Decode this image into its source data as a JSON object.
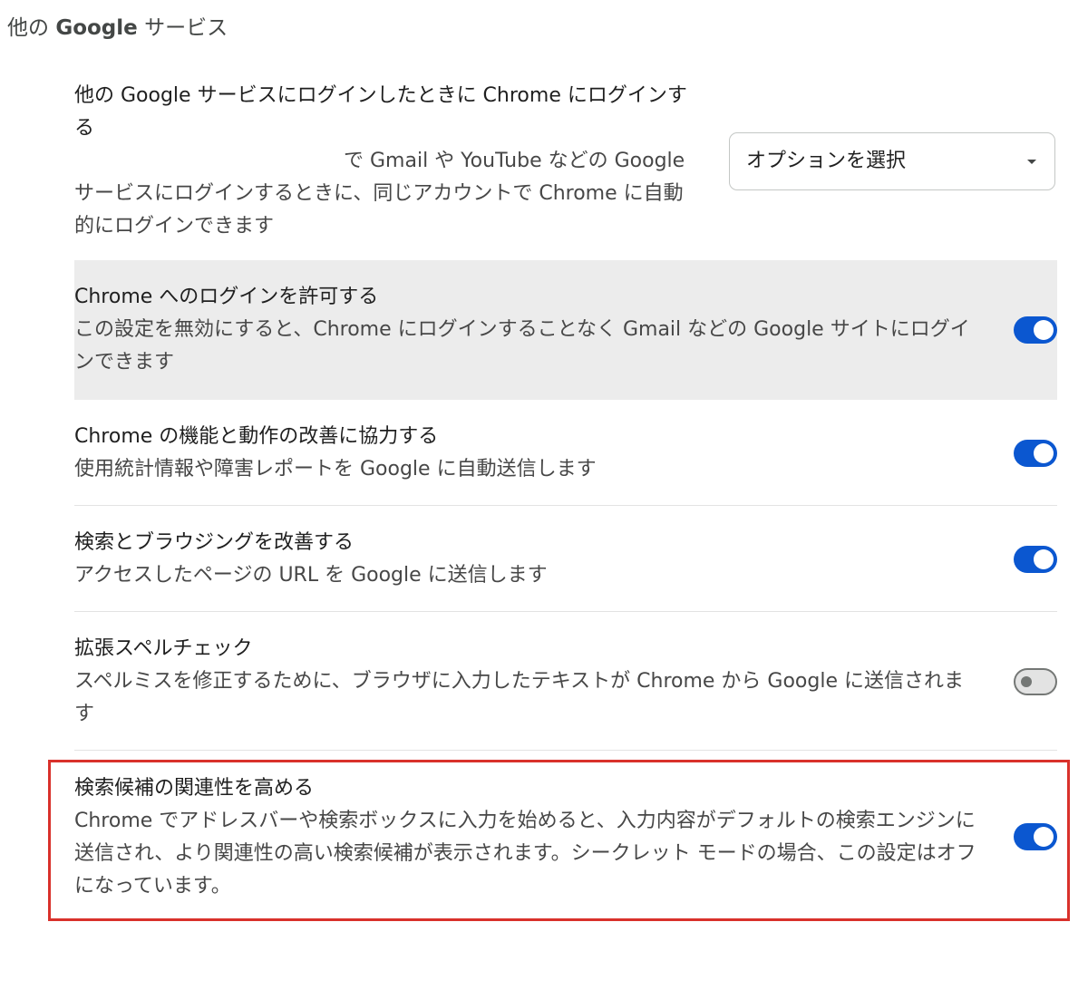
{
  "section": {
    "title_prefix": "他の",
    "title_bold": "Google",
    "title_suffix": "サービス"
  },
  "settings": {
    "signin_sync": {
      "title": "他の Google サービスにログインしたときに Chrome にログインする",
      "desc_part1": "で Gmail や YouTube などの Google",
      "desc_part2": "サービスにログインするときに、同じアカウントで Chrome に自動的にログインできます",
      "select_value": "オプションを選択"
    },
    "allow_signin": {
      "title": "Chrome へのログインを許可する",
      "desc": "この設定を無効にすると、Chrome にログインすることなく Gmail などの Google サイトにログインできます",
      "enabled": true
    },
    "improve": {
      "title": "Chrome の機能と動作の改善に協力する",
      "desc": "使用統計情報や障害レポートを Google に自動送信します",
      "enabled": true
    },
    "search_browse": {
      "title": "検索とブラウジングを改善する",
      "desc": "アクセスしたページの URL を Google に送信します",
      "enabled": true
    },
    "spell": {
      "title": "拡張スペルチェック",
      "desc": "スペルミスを修正するために、ブラウザに入力したテキストが Chrome から Google に送信されます",
      "enabled": false
    },
    "suggest": {
      "title": "検索候補の関連性を高める",
      "desc": "Chrome でアドレスバーや検索ボックスに入力を始めると、入力内容がデフォルトの検索エンジンに送信され、より関連性の高い検索候補が表示されます。シークレット モードの場合、この設定はオフになっています。",
      "enabled": true
    }
  },
  "colors": {
    "toggle_on": "#0b57d0",
    "highlight_border": "#d9312b",
    "highlight_row_bg": "#ececec"
  }
}
